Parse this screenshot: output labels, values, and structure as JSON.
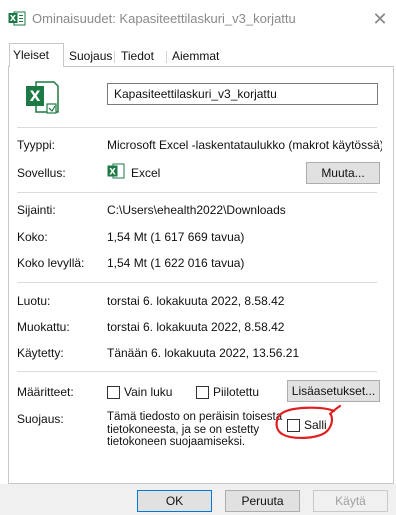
{
  "window": {
    "title": "Ominaisuudet: Kapasiteettilaskuri_v3_korjattu",
    "close_icon": "close-icon"
  },
  "tabs": [
    {
      "label": "Yleiset",
      "active": true
    },
    {
      "label": "Suojaus",
      "active": false
    },
    {
      "label": "Tiedot",
      "active": false
    },
    {
      "label": "Aiemmat versiot",
      "active": false
    }
  ],
  "general": {
    "file_name": "Kapasiteettilaskuri_v3_korjattu",
    "type_label": "Tyyppi:",
    "type_value": "Microsoft Excel -laskentataulukko (makrot käytössä) (.xl",
    "opens_with_label": "Sovellus:",
    "opens_with_value": "Excel",
    "change_button": "Muuta...",
    "location_label": "Sijainti:",
    "location_value": "C:\\Users\\ehealth2022\\Downloads",
    "size_label": "Koko:",
    "size_value": "1,54 Mt (1 617 669 tavua)",
    "size_on_disk_label": "Koko levyllä:",
    "size_on_disk_value": "1,54 Mt (1 622 016 tavua)",
    "created_label": "Luotu:",
    "created_value": "torstai 6. lokakuuta 2022, 8.58.42",
    "modified_label": "Muokattu:",
    "modified_value": "torstai 6. lokakuuta 2022, 8.58.42",
    "accessed_label": "Käytetty:",
    "accessed_value": "Tänään 6. lokakuuta 2022, 13.56.21",
    "attributes_label": "Määritteet:",
    "readonly_label": "Vain luku",
    "readonly_checked": false,
    "hidden_label": "Piilotettu",
    "hidden_checked": false,
    "advanced_button": "Lisäasetukset...",
    "security_label": "Suojaus:",
    "security_text_lines": [
      "Tämä tiedosto on peräisin toisesta",
      "tietokoneesta, ja se on estetty",
      "tietokoneen suojaamiseksi."
    ],
    "unblock_label": "Salli",
    "unblock_checked": false,
    "annotation_color": "#e02020"
  },
  "footer": {
    "ok": "OK",
    "cancel": "Peruuta",
    "apply": "Käytä"
  },
  "colors": {
    "excel_green": "#1d7a44",
    "default_button_border": "#0078d7"
  }
}
